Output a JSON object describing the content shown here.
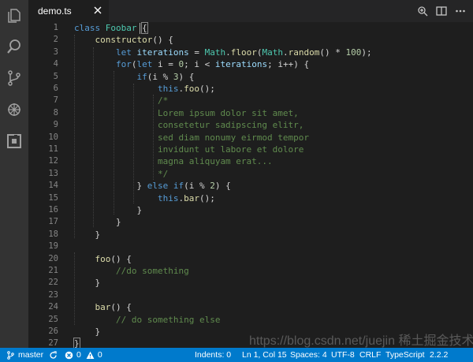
{
  "tab": {
    "filename": "demo.ts"
  },
  "activity_icons": [
    "files-icon",
    "search-icon",
    "source-control-icon",
    "debug-icon",
    "extensions-icon"
  ],
  "editor": {
    "line_numbers": [
      "1",
      "2",
      "3",
      "4",
      "5",
      "6",
      "7",
      "8",
      "9",
      "10",
      "11",
      "12",
      "13",
      "14",
      "15",
      "16",
      "17",
      "18",
      "19",
      "20",
      "21",
      "22",
      "23",
      "24",
      "25",
      "26",
      "27"
    ]
  },
  "code": {
    "l1": {
      "kw": "class",
      "name": "Foobar",
      "brace": "{"
    },
    "l2": {
      "fn": "constructor",
      "rest": "() {"
    },
    "l3": {
      "kw": "let",
      "var": "iterations",
      "eq": " = ",
      "cls": "Math",
      "dot1": ".",
      "fn1": "floor",
      "p1": "(",
      "cls2": "Math",
      "dot2": ".",
      "fn2": "random",
      "rest": "() * ",
      "num": "100",
      "end": ");"
    },
    "l4": {
      "kw": "for",
      "p": "(",
      "kw2": "let",
      "mid": " i = ",
      "num": "0",
      "mid2": "; i < ",
      "var": "iterations",
      "end": "; i++) {"
    },
    "l5": {
      "kw": "if",
      "p": "(i % ",
      "num": "3",
      "end": ") {"
    },
    "l6": {
      "kw": "this",
      "dot": ".",
      "fn": "foo",
      "end": "();"
    },
    "l7": "/*",
    "l8": "Lorem ipsum dolor sit amet,",
    "l9": "consetetur sadipscing elitr,",
    "l10": "sed diam nonumy eirmod tempor",
    "l11": "invidunt ut labore et dolore",
    "l12": "magna aliquyam erat...",
    "l13": "*/",
    "l14": {
      "a": "} ",
      "kw": "else",
      "sp": " ",
      "kw2": "if",
      "p": "(i % ",
      "num": "2",
      "end": ") {"
    },
    "l15": {
      "kw": "this",
      "dot": ".",
      "fn": "bar",
      "end": "();"
    },
    "l16": "}",
    "l17": "}",
    "l18": "}",
    "l20": {
      "fn": "foo",
      "end": "() {"
    },
    "l21": "//do something",
    "l22": "}",
    "l24": {
      "fn": "bar",
      "end": "() {"
    },
    "l25": "// do something else",
    "l26": "}",
    "l27": "}"
  },
  "statusbar": {
    "branch": "master",
    "errors": "0",
    "warnings": "0",
    "indent": "Indents: 0",
    "position": "Ln 1, Col 15",
    "spaces": "Spaces: 4",
    "encoding": "UTF-8",
    "eol": "CRLF",
    "language": "TypeScript",
    "version": "2.2.2"
  },
  "watermark": "https://blog.csdn.net/juejin 稀土掘金技术社区",
  "colors": {
    "status_bar": "#007acc",
    "activity_bar": "#333333",
    "editor_bg": "#1e1e1e",
    "keyword": "#569cd6",
    "comment": "#608b4e"
  }
}
